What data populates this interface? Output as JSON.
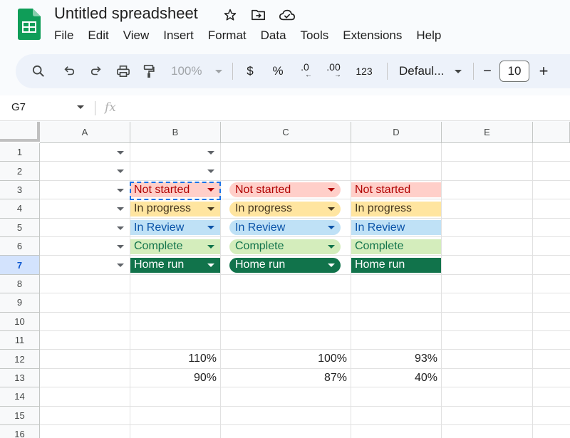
{
  "app": {
    "title": "Untitled spreadsheet",
    "menu": [
      "File",
      "Edit",
      "View",
      "Insert",
      "Format",
      "Data",
      "Tools",
      "Extensions",
      "Help"
    ]
  },
  "toolbar": {
    "zoom": "100%",
    "currency": "$",
    "percent": "%",
    "decrease_decimal": ".0",
    "increase_decimal": ".00",
    "more_formats": "123",
    "font": "Defaul...",
    "font_size": "10",
    "minus": "−",
    "plus": "+"
  },
  "formula_bar": {
    "name_box": "G7",
    "fx": "fx"
  },
  "columns": [
    "A",
    "B",
    "C",
    "D",
    "E"
  ],
  "rows": [
    "1",
    "2",
    "3",
    "4",
    "5",
    "6",
    "7",
    "8",
    "9",
    "10",
    "11",
    "12",
    "13",
    "14",
    "15",
    "16"
  ],
  "active_row": "7",
  "status_chips": {
    "B": [
      "Not started",
      "In progress",
      "In Review",
      "Complete",
      "Home run"
    ],
    "C": [
      "Not started",
      "In progress",
      "In Review",
      "Complete",
      "Home run"
    ],
    "D": [
      "Not started",
      "In progress",
      "In Review",
      "Complete",
      "Home run"
    ]
  },
  "values": {
    "B12": "110%",
    "C12": "100%",
    "D12": "93%",
    "B13": "90%",
    "C13": "87%",
    "D13": "40%"
  },
  "colors": {
    "not_started_bg": "#ffcfc9",
    "in_progress_bg": "#ffe5a0",
    "in_review_bg": "#bfe1f6",
    "complete_bg": "#d4edbc",
    "home_run_bg": "#11734b",
    "sheets_green": "#0f9d58",
    "selection": "#1a73e8"
  }
}
